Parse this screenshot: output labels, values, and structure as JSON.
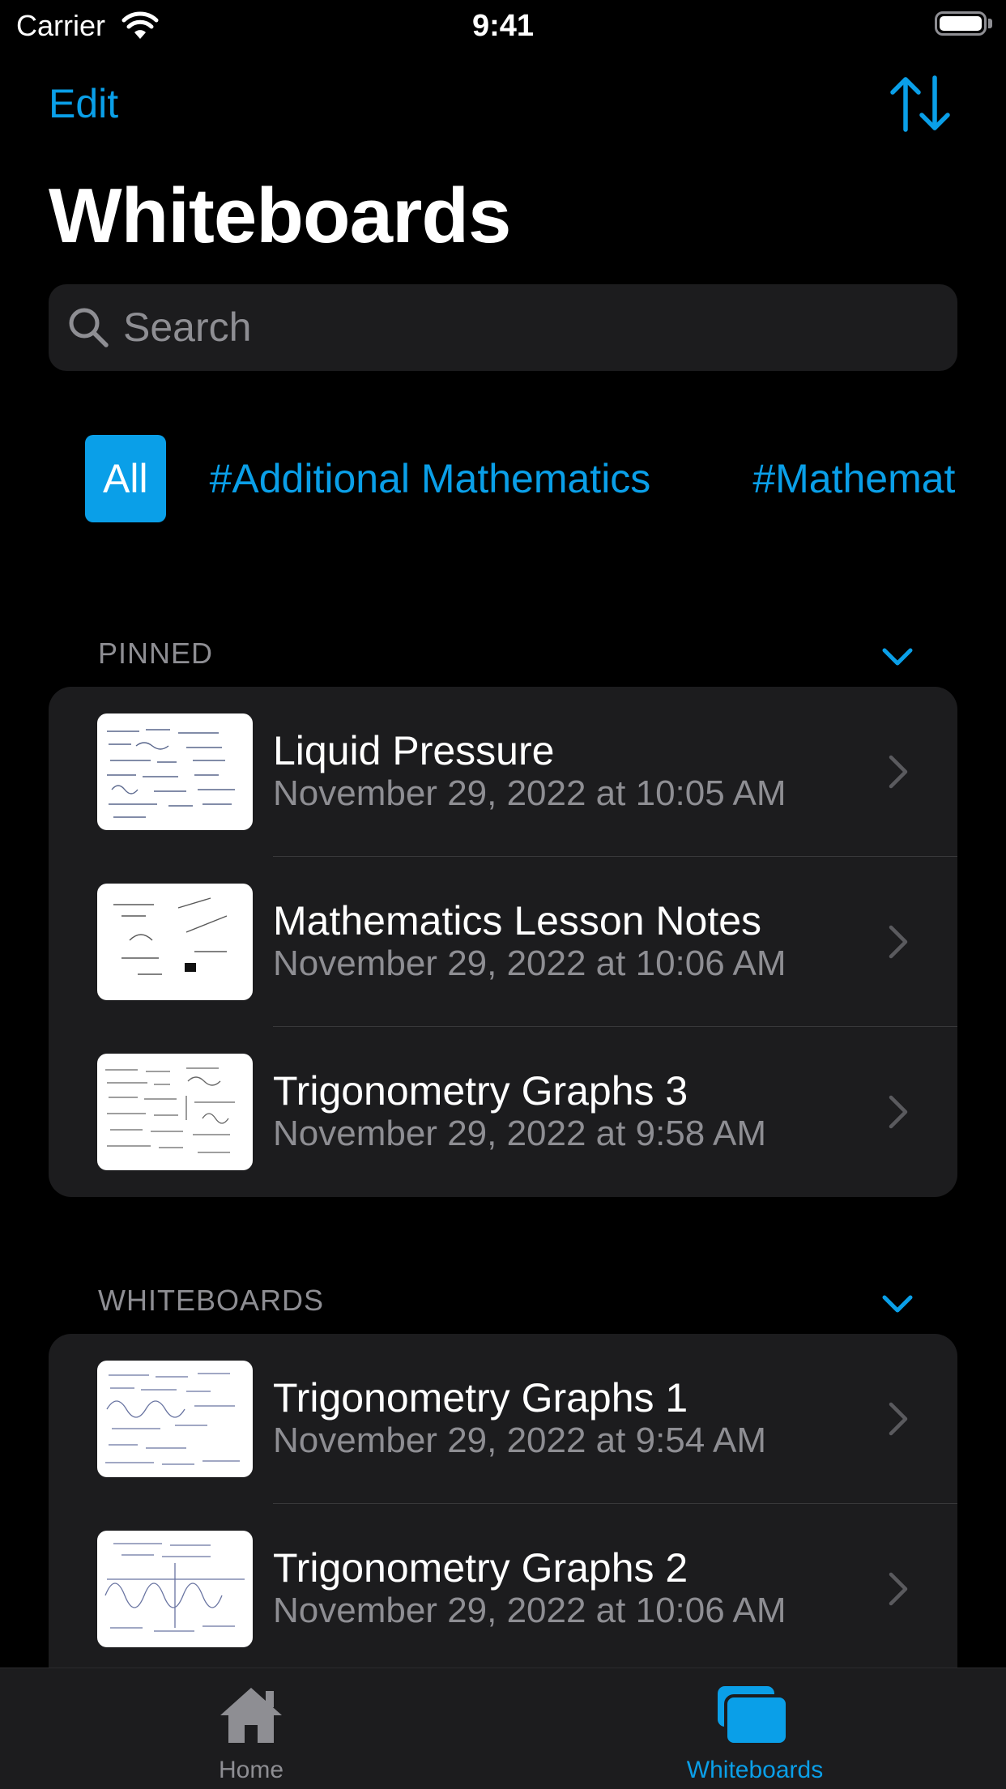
{
  "status_bar": {
    "carrier": "Carrier",
    "time": "9:41"
  },
  "nav": {
    "edit_label": "Edit",
    "sort_icon": "sort-arrows-icon"
  },
  "title": "Whiteboards",
  "search": {
    "placeholder": "Search",
    "value": ""
  },
  "filters": [
    {
      "label": "All",
      "selected": true
    },
    {
      "label": "#Additional Mathematics",
      "selected": false
    },
    {
      "label": "#Mathematics",
      "selected": false
    }
  ],
  "sections": {
    "pinned": {
      "header": "PINNED",
      "items": [
        {
          "title": "Liquid Pressure",
          "date": "November 29, 2022 at 10:05 AM"
        },
        {
          "title": "Mathematics Lesson Notes",
          "date": "November 29, 2022 at 10:06 AM"
        },
        {
          "title": "Trigonometry Graphs 3",
          "date": "November 29, 2022 at 9:58 AM"
        }
      ]
    },
    "whiteboards": {
      "header": "WHITEBOARDS",
      "items": [
        {
          "title": "Trigonometry Graphs 1",
          "date": "November 29, 2022 at 9:54 AM"
        },
        {
          "title": "Trigonometry Graphs 2",
          "date": "November 29, 2022 at 10:06 AM"
        }
      ]
    }
  },
  "tabbar": {
    "tabs": [
      {
        "label": "Home",
        "icon": "house-icon",
        "active": false
      },
      {
        "label": "Whiteboards",
        "icon": "whiteboards-icon",
        "active": true
      }
    ]
  },
  "colors": {
    "accent": "#0a9fe8",
    "background": "#000000",
    "card": "#1c1c1e",
    "secondary_text": "#8e8e93",
    "inactive_tab": "#8e8e93"
  }
}
